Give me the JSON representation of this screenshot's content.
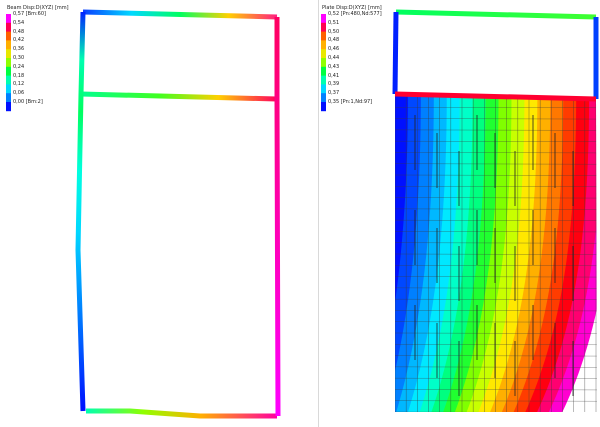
{
  "left_panel": {
    "legend_title": "Beam Disp:D(XYZ) [mm]",
    "ticks": [
      "0,57 [Bm:60]",
      "0,54",
      "0,48",
      "0,42",
      "0,36",
      "0,30",
      "0,24",
      "0,18",
      "0,12",
      "0,06",
      "0,00 [Bm:2]"
    ]
  },
  "right_panel": {
    "legend_title": "Plate Disp:D(XYZ) [mm]",
    "ticks": [
      "0,52 [Pn:480,Nd:577]",
      "0,51",
      "0,50",
      "0,48",
      "0,46",
      "0,44",
      "0,43",
      "0,41",
      "0,39",
      "0,37",
      "0,35 [Pn:1,Nd:97]"
    ]
  },
  "colors": {
    "scale": [
      "#ff00ff",
      "#ff0050",
      "#ff6000",
      "#ffb000",
      "#e8e800",
      "#90ff00",
      "#00ff40",
      "#00ffb0",
      "#00d8ff",
      "#0080ff",
      "#0010ff"
    ],
    "divider": "#d9d9d9",
    "mesh": "#3a3a3a"
  }
}
